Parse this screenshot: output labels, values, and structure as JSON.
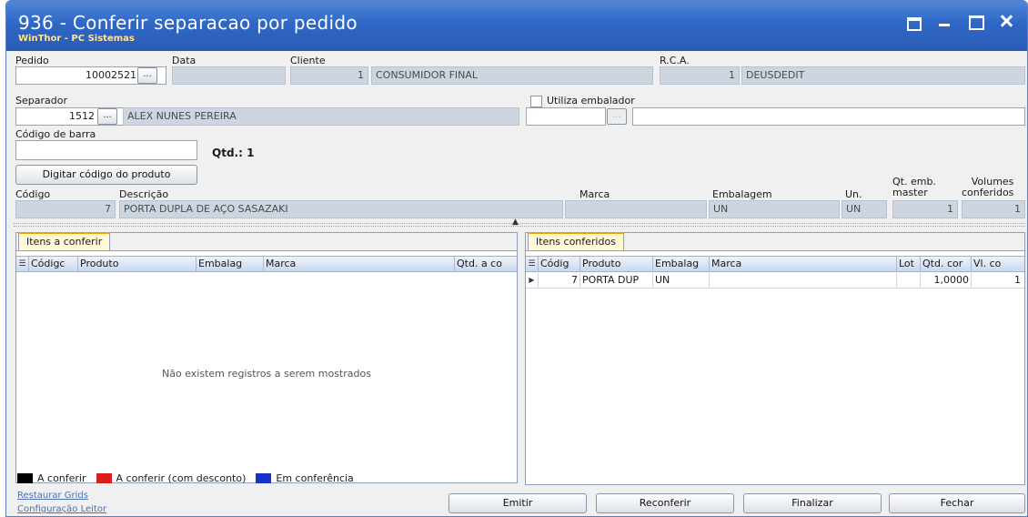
{
  "window": {
    "title": "936 - Conferir separacao por pedido",
    "subtitle": "WinThor - PC Sistemas"
  },
  "form": {
    "pedido_label": "Pedido",
    "pedido_value": "10002521",
    "ellipsis": "...",
    "data_label": "Data",
    "cliente_label": "Cliente",
    "cliente_code": "1",
    "cliente_name": "CONSUMIDOR FINAL",
    "rca_label": "R.C.A.",
    "rca_code": "1",
    "rca_name": "DEUSDEDIT",
    "separador_label": "Separador",
    "separador_code": "1512",
    "separador_name": "ALEX NUNES PEREIRA",
    "embalador_label": "Utiliza embalador",
    "barcode_label": "Código de barra",
    "qtd_text": "Qtd.: 1",
    "digitar_button": "Digitar código do produto"
  },
  "product": {
    "codigo_label": "Código",
    "descricao_label": "Descrição",
    "marca_label": "Marca",
    "embalagem_label": "Embalagem",
    "un_label": "Un.",
    "qt_emb_label_1": "Qt. emb.",
    "qt_emb_label_2": "master",
    "volumes_label_1": "Volumes",
    "volumes_label_2": "conferidos",
    "codigo": "7",
    "descricao": "PORTA DUPLA DE AÇO SASAZAKI",
    "marca": "",
    "embalagem": "UN",
    "un": "UN",
    "qt_emb": "1",
    "volumes": "1"
  },
  "left_panel": {
    "tab": "Itens a conferir",
    "columns": [
      "Códigc",
      "Produto",
      "Embalag",
      "Marca",
      "Qtd. a co"
    ],
    "empty_message": "Não existem registros a serem mostrados"
  },
  "right_panel": {
    "tab": "Itens conferidos",
    "columns": [
      "Códig",
      "Produto",
      "Embalag",
      "Marca",
      "Lot",
      "Qtd. cor",
      "Vl. co"
    ],
    "rows": [
      {
        "codigo": "7",
        "produto": "PORTA DUP",
        "embalagem": "UN",
        "marca": "",
        "lote": "",
        "qtd": "1,0000",
        "vl": "1"
      }
    ]
  },
  "legend": [
    {
      "label": "A conferir",
      "color": "#000000"
    },
    {
      "label": "A conferir (com desconto)",
      "color": "#d81f1f"
    },
    {
      "label": "Em conferência",
      "color": "#1b2fc9"
    }
  ],
  "footer": {
    "restaurar_link": "Restaurar Grids",
    "config_link": "Configuração Leitor",
    "emitir": "Emitir",
    "reconferir": "Reconferir",
    "finalizar": "Finalizar",
    "fechar": "Fechar"
  }
}
